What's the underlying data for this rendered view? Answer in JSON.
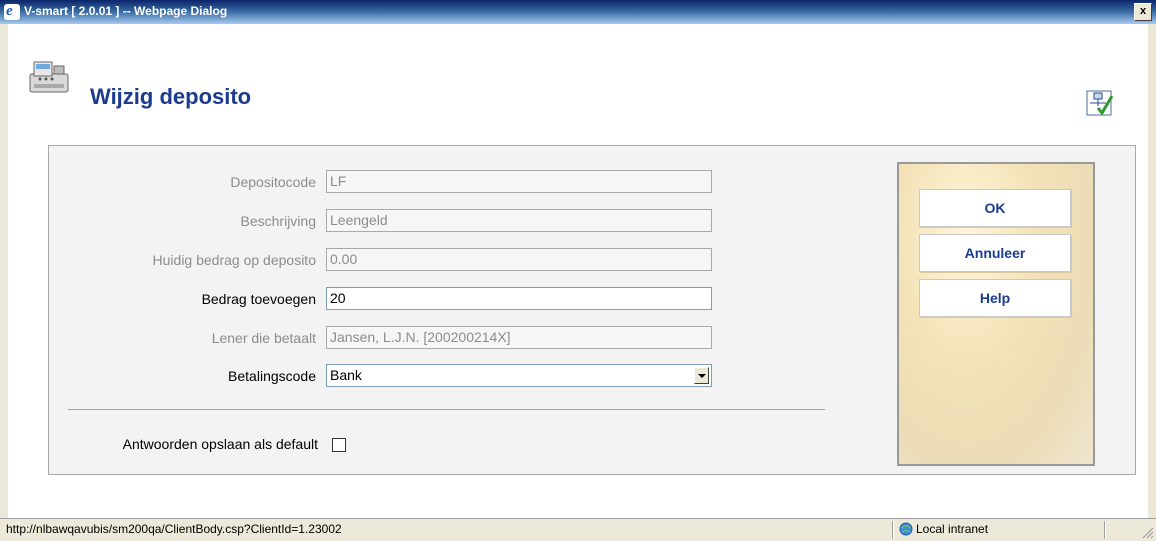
{
  "window": {
    "title": "V-smart [ 2.0.01 ] -- Webpage Dialog",
    "close_label": "x"
  },
  "page": {
    "title": "Wijzig deposito"
  },
  "form": {
    "fields": [
      {
        "label": "Depositocode",
        "value": "LF",
        "enabled": false
      },
      {
        "label": "Beschrijving",
        "value": "Leengeld",
        "enabled": false
      },
      {
        "label": "Huidig bedrag op deposito",
        "value": "0.00",
        "enabled": false
      },
      {
        "label": "Bedrag toevoegen",
        "value": "20",
        "enabled": true
      },
      {
        "label": "Lener die betaalt",
        "value": "Jansen, L.J.N. [200200214X]",
        "enabled": false
      }
    ],
    "payment": {
      "label": "Betalingscode",
      "value": "Bank"
    },
    "save_default": {
      "label": "Antwoorden opslaan als default",
      "checked": false
    }
  },
  "buttons": {
    "ok": "OK",
    "cancel": "Annuleer",
    "help": "Help"
  },
  "status": {
    "url": "http://nlbawqavubis/sm200qa/ClientBody.csp?ClientId=1.23002",
    "zone": "Local intranet"
  },
  "colors": {
    "title_blue": "#1b3b8f",
    "titlebar": "#0a246a"
  }
}
